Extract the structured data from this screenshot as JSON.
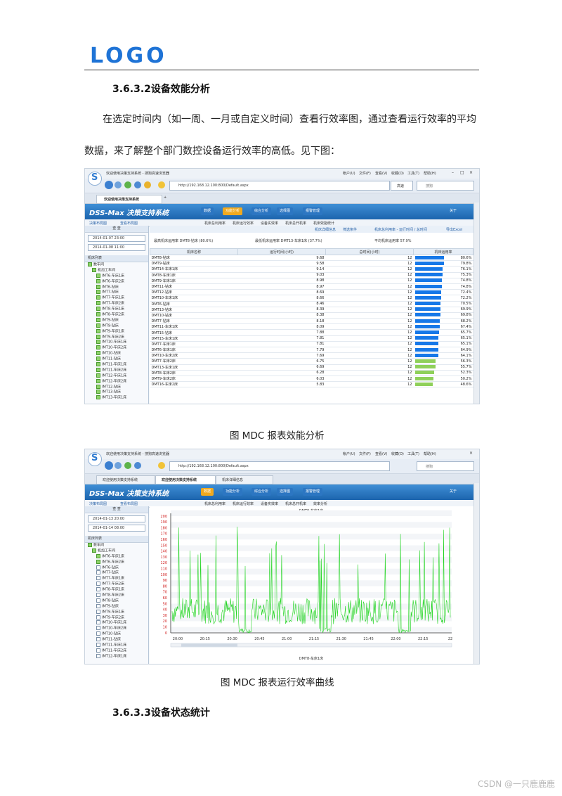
{
  "header": {
    "logo_text": "LOGO"
  },
  "section1": {
    "heading": "3.6.3.2设备效能分析",
    "para_line1": "在选定时间内（如一周、一月或自定义时间）查看行效率图，通过查看运行效率的平均",
    "para_line2": "数据，来了解整个部门数控设备运行效率的高低。见下图："
  },
  "shot1": {
    "window_title": "欢迎使用决策支持系统 - 搜狗高速浏览器",
    "menu": [
      "帐户(U)",
      "文件(F)",
      "查看(V)",
      "收藏(O)",
      "工具(T)",
      "帮助(H)"
    ],
    "url": "http://192.168.12.100:800/Default.aspx",
    "search_placeholder": "搜狗",
    "mode": "高速",
    "tabs": [
      "欢迎使用决策支持系统"
    ],
    "app_name": "DSS-Max 决策支持系统",
    "nav": [
      "数据",
      "功能分析",
      "综合分析",
      "选择图",
      "报警管理"
    ],
    "nav_right": "关于",
    "side_tabs": [
      "决策布局图",
      "查看布局图"
    ],
    "sub_tabs": [
      "机床总利用率",
      "机床运行效率",
      "设备实效率",
      "机床总开机率",
      "机床效能统计"
    ],
    "query_label": "查 查",
    "date_from": "2014-01-07 23:00",
    "date_to": "2014-01-08 11:00",
    "tree_title": "机床列表",
    "tree": [
      "数车间",
      "机加工车间",
      "IMT6-车床1床",
      "IMT6-车床2床",
      "IMT6-钻床",
      "IMT7-钻床",
      "IMT7-车床1床",
      "IMT7-车床2床",
      "IMT8-车床1床",
      "IMT8-车床2床",
      "IMT9-钻床",
      "IMT9-钻床",
      "IMT9-车床1床",
      "IMT9-车床2床",
      "IMT10-车床1床",
      "IMT10-车床2床",
      "IMT10-钻床",
      "IMT11-钻床",
      "IMT11-车床1床",
      "IMT11-车床2床",
      "IMT12-车床1床",
      "IMT12-车床2床",
      "IMT12-钻床",
      "IMT13-钻床",
      "IMT13-车床1床"
    ],
    "toolbar_links": [
      "机床详细信息",
      "筛选条件",
      "机床总利用率 - 运行时间 / 总时间",
      "导出Excel"
    ],
    "summary": [
      "最高机床运用率 DMT8-钻床 (80.6%)",
      "最低机床运用率 DMT13-车床1床 (37.7%)",
      "平均机床运用率 57.9%"
    ],
    "columns": [
      "机床名称",
      "运行时间(小时)",
      "总时间(小时)",
      "机床运用率"
    ],
    "rows": [
      {
        "name": "DMT8-钻床",
        "run": "9.68",
        "total": "12",
        "pct": "80.6%"
      },
      {
        "name": "DMT9-钻床",
        "run": "9.58",
        "total": "12",
        "pct": "79.8%"
      },
      {
        "name": "DMT14-车床1床",
        "run": "9.14",
        "total": "12",
        "pct": "76.1%"
      },
      {
        "name": "DMT8-车床1床",
        "run": "9.03",
        "total": "12",
        "pct": "75.3%"
      },
      {
        "name": "DMT9-车床1床",
        "run": "8.98",
        "total": "12",
        "pct": "74.8%"
      },
      {
        "name": "DMT11-钻床",
        "run": "8.97",
        "total": "12",
        "pct": "74.8%"
      },
      {
        "name": "DMT12-钻床",
        "run": "8.69",
        "total": "12",
        "pct": "72.4%"
      },
      {
        "name": "DMT10-车床1床",
        "run": "8.66",
        "total": "12",
        "pct": "72.2%"
      },
      {
        "name": "DMT6-钻床",
        "run": "8.46",
        "total": "12",
        "pct": "70.5%"
      },
      {
        "name": "DMT13-钻床",
        "run": "8.39",
        "total": "12",
        "pct": "69.9%"
      },
      {
        "name": "DMT10-钻床",
        "run": "8.38",
        "total": "12",
        "pct": "69.8%"
      },
      {
        "name": "DMT7-钻床",
        "run": "8.18",
        "total": "12",
        "pct": "68.2%"
      },
      {
        "name": "DMT11-车床1床",
        "run": "8.09",
        "total": "12",
        "pct": "67.4%"
      },
      {
        "name": "DMT15-钻床",
        "run": "7.88",
        "total": "12",
        "pct": "65.7%"
      },
      {
        "name": "DMT15-车床1床",
        "run": "7.81",
        "total": "12",
        "pct": "65.1%"
      },
      {
        "name": "DMT7-车床1床",
        "run": "7.81",
        "total": "12",
        "pct": "65.1%"
      },
      {
        "name": "DMT6-车床1床",
        "run": "7.79",
        "total": "12",
        "pct": "64.9%"
      },
      {
        "name": "DMT10-车床2床",
        "run": "7.69",
        "total": "12",
        "pct": "64.1%"
      },
      {
        "name": "DMT7-车床2床",
        "run": "6.75",
        "total": "12",
        "pct": "56.3%"
      },
      {
        "name": "DMT13-车床1床",
        "run": "6.69",
        "total": "12",
        "pct": "55.7%"
      },
      {
        "name": "DMT8-车床2床",
        "run": "6.28",
        "total": "12",
        "pct": "52.3%"
      },
      {
        "name": "DMT9-车床2床",
        "run": "6.03",
        "total": "12",
        "pct": "50.2%"
      },
      {
        "name": "DMT16-车床2床",
        "run": "5.83",
        "total": "12",
        "pct": "48.6%"
      }
    ],
    "high_color": "#1678e8",
    "low_color": "#8fd05a"
  },
  "caption1": "图  MDC 报表效能分析",
  "shot2": {
    "window_title": "欢迎使用决策支持系统 - 搜狗高速浏览器",
    "tabs": [
      "欢迎使用决策支持系统",
      "欢迎使用决策支持系统",
      "机床详细信息"
    ],
    "url": "http://192.168.12.100:800/Default.aspx",
    "date_from": "2014-01-13 20:00",
    "date_to": "2014-01-14 08:00",
    "sub_tabs": [
      "机床总利用率",
      "机床运行效率",
      "设备实效率",
      "机床总开机率",
      "效率分析"
    ],
    "tree": [
      "数车间",
      "机加工车间",
      "IMT6-车床1床",
      "IMT6-车床2床",
      "IMT6-钻床",
      "IMT7-钻床",
      "IMT7-车床1床",
      "IMT7-车床2床",
      "IMT8-车床1床",
      "IMT8-车床2床",
      "IMT8-钻床",
      "IMT9-钻床",
      "IMT9-车床1床",
      "IMT9-车床2床",
      "IMT10-车床1床",
      "IMT10-车床2床",
      "IMT10-钻床",
      "IMT11-钻床",
      "IMT11-车床1床",
      "IMT11-车床2床",
      "IMT12-车床1床"
    ],
    "chart_title": "DMT8-车床1床",
    "chart_title_bottom": "DMT8-车床1床"
  },
  "chart_data": {
    "type": "line",
    "title": "DMT8-车床1床",
    "x_ticks": [
      "20:00",
      "20:15",
      "20:30",
      "20:45",
      "21:00",
      "21:15",
      "21:30",
      "21:45",
      "22:00",
      "22:15",
      "22"
    ],
    "y_ticks": [
      0,
      10,
      20,
      30,
      40,
      50,
      60,
      70,
      80,
      90,
      100,
      110,
      120,
      130,
      140,
      150,
      160,
      170,
      180,
      190,
      200
    ],
    "ylim": [
      0,
      200
    ],
    "series": [
      {
        "color": "#22d422"
      }
    ],
    "grid": true
  },
  "caption2": "图  MDC 报表运行效率曲线",
  "section2": {
    "heading": "3.6.3.3设备状态统计"
  },
  "watermark": "CSDN @一只鹿鹿鹿"
}
